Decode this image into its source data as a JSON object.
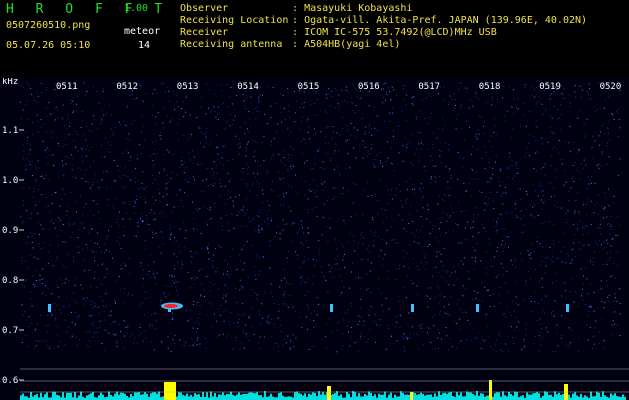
{
  "header": {
    "app_name": "H R O F F T",
    "app_version": "1.00",
    "filename": "0507260510.png",
    "datetime": "05.07.26 05:10",
    "meteor_label": "meteor",
    "meteor_count": "14",
    "info": [
      {
        "key": "Observer",
        "sep": ":",
        "value": "Masayuki Kobayashi"
      },
      {
        "key": "Receiving Location",
        "sep": ":",
        "value": "Ogata-vill. Akita-Pref. JAPAN (139.96E, 40.02N)"
      },
      {
        "key": "Receiver",
        "sep": ":",
        "value": "ICOM IC-575 53.7492(@LCD)MHz USB"
      },
      {
        "key": "Receiving antenna",
        "sep": ":",
        "value": "A504HB(yagi 4el)"
      }
    ]
  },
  "spectrogram": {
    "y_unit": "kHz",
    "y_ticks": [
      "1.1",
      "1.0",
      "0.9",
      "0.8",
      "0.7",
      "0.6"
    ],
    "time_labels": [
      "0511",
      "0512",
      "0513",
      "0514",
      "0515",
      "0516",
      "0517",
      "0518",
      "0519",
      "0520"
    ],
    "colors": {
      "background": "#000010",
      "noise_dim": "#1a2fa0",
      "noise_bright": "#3f7cff",
      "tick_label": "#ffffff",
      "time_label": "#ffffff",
      "signal_core": "#ff2020",
      "signal_halo": "#40c0ff",
      "power_trace": "#00e0e0",
      "power_peak": "#ffff00",
      "ref_line": "#b0b0b0"
    }
  }
}
